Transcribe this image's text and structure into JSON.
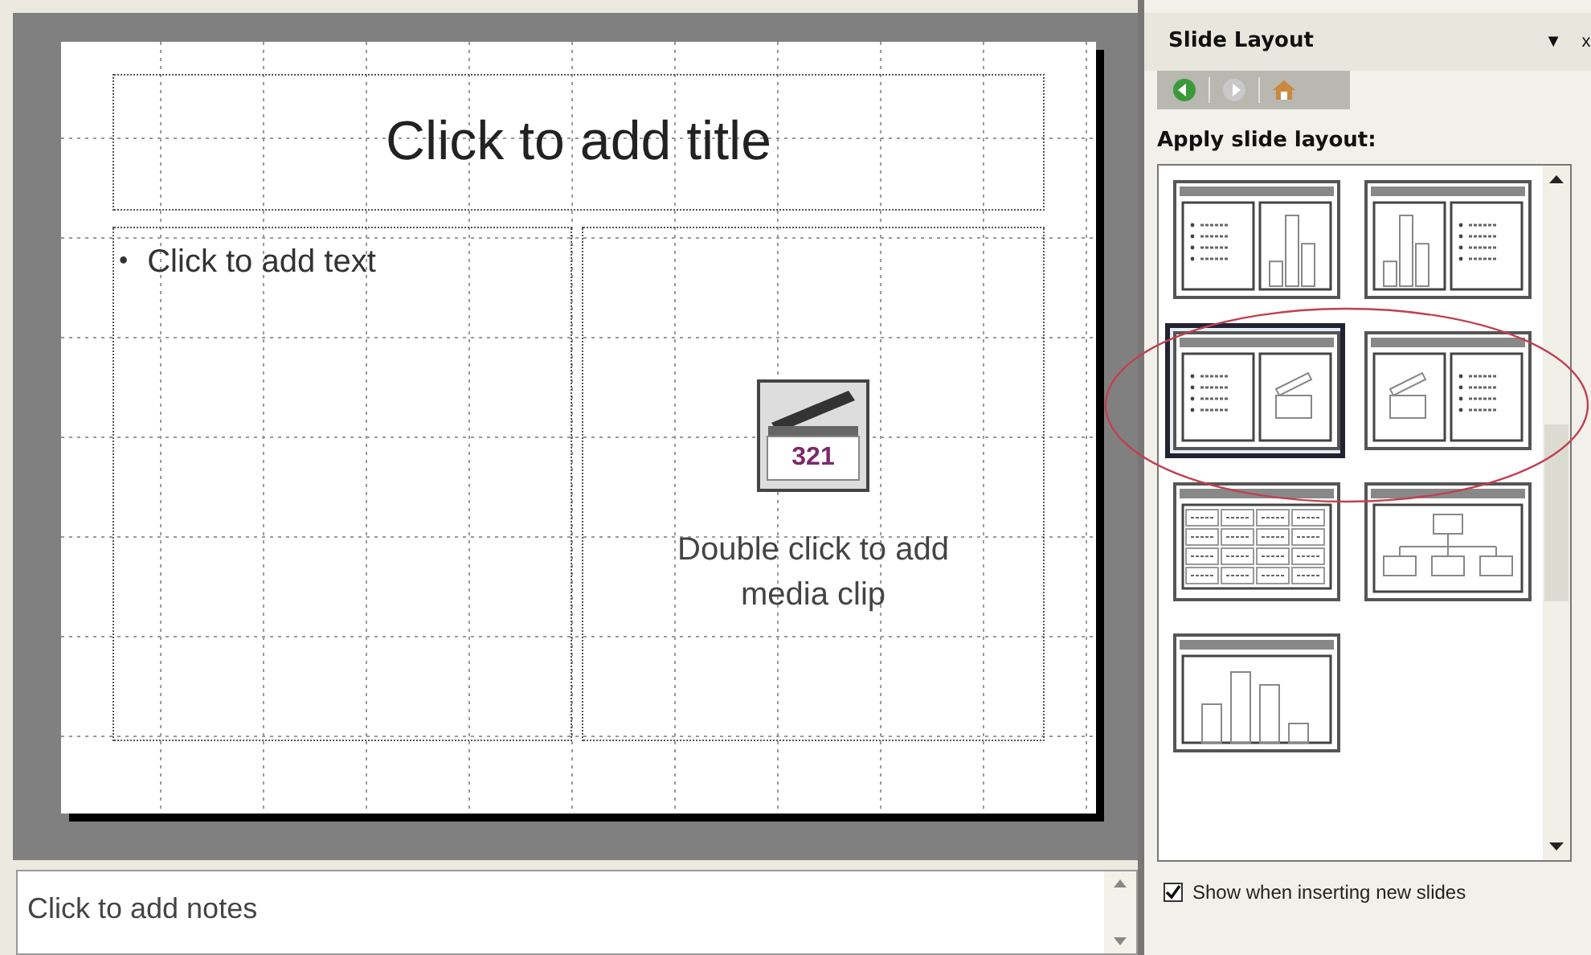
{
  "slide": {
    "title_placeholder": "Click to add title",
    "text_placeholder": {
      "bullet": "•",
      "text": "Click to add text"
    },
    "media_placeholder": {
      "icon_digits": "321",
      "text": "Double click to add media clip"
    }
  },
  "notes": {
    "placeholder": "Click to add notes"
  },
  "task_pane": {
    "title": "Slide Layout",
    "menu_glyph": "▼",
    "close_glyph": "x",
    "nav": [
      {
        "kind": "back",
        "disabled": false
      },
      {
        "kind": "forward",
        "disabled": true
      },
      {
        "kind": "home",
        "disabled": false
      }
    ],
    "section_label": "Apply slide layout:",
    "layouts": [
      {
        "kind": "text-chart",
        "selected": false
      },
      {
        "kind": "chart-text",
        "selected": false
      },
      {
        "kind": "text-media",
        "selected": true
      },
      {
        "kind": "media-text",
        "selected": false
      },
      {
        "kind": "table",
        "selected": false
      },
      {
        "kind": "diagram",
        "selected": false
      },
      {
        "kind": "chart",
        "selected": false
      }
    ],
    "show_when_inserting": {
      "label": "Show when inserting new slides",
      "checked": true
    }
  }
}
